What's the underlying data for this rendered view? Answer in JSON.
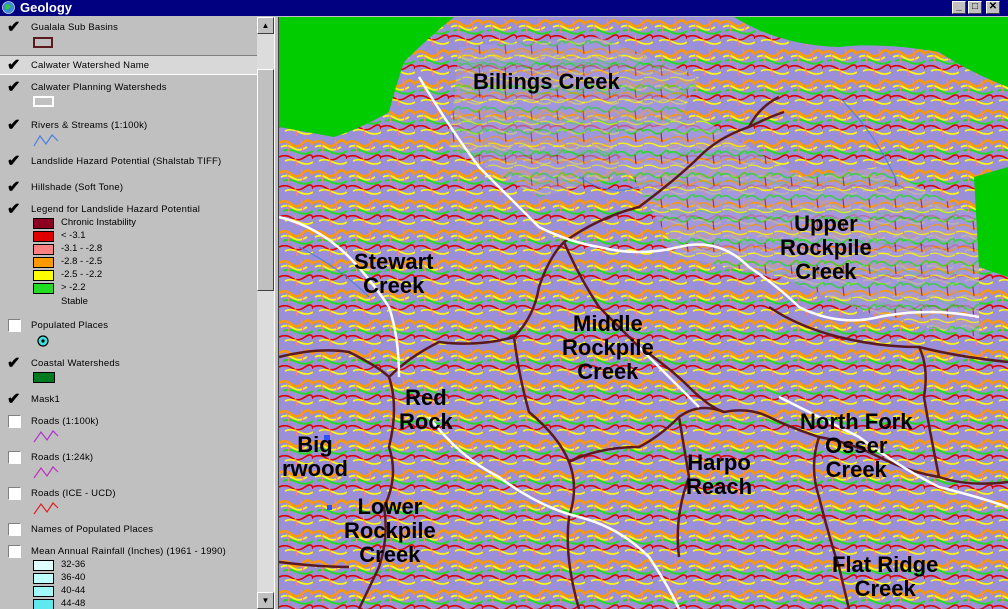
{
  "window": {
    "title": "Geology"
  },
  "toc": {
    "layers": [
      {
        "name": "Gualala Sub Basins",
        "checked": true
      },
      {
        "name": "Calwater Watershed Name",
        "checked": true
      },
      {
        "name": "Calwater Planning Watersheds",
        "checked": true
      },
      {
        "name": "Rivers & Streams (1:100k)",
        "checked": true
      },
      {
        "name": "Landslide Hazard Potential (Shalstab TIFF)",
        "checked": true
      },
      {
        "name": "Hillshade (Soft Tone)",
        "checked": true
      },
      {
        "name": "Legend for Landslide Hazard Potential",
        "checked": true
      },
      {
        "name": "Populated Places",
        "checked": false
      },
      {
        "name": "Coastal Watersheds",
        "checked": true
      },
      {
        "name": "Mask1",
        "checked": true
      },
      {
        "name": "Roads (1:100k)",
        "checked": false
      },
      {
        "name": "Roads (1:24k)",
        "checked": false
      },
      {
        "name": "Roads (ICE - UCD)",
        "checked": false
      },
      {
        "name": "Names of Populated Places",
        "checked": false
      },
      {
        "name": "Mean Annual Rainfall (Inches) (1961 - 1990)",
        "checked": false
      }
    ],
    "hazard_legend": [
      {
        "label": "Chronic Instability",
        "color": "#8b0020"
      },
      {
        "label": "< -3.1",
        "color": "#e00000"
      },
      {
        "label": "-3.1 - -2.8",
        "color": "#ff8080"
      },
      {
        "label": "-2.8 - -2.5",
        "color": "#ff9900"
      },
      {
        "label": "-2.5 - -2.2",
        "color": "#ffff00"
      },
      {
        "label": "> -2.2",
        "color": "#22dd22"
      }
    ],
    "hazard_stable_label": "Stable",
    "rainfall_legend": [
      {
        "label": "32-36",
        "color": "#e0ffff"
      },
      {
        "label": "36-40",
        "color": "#c0ffff"
      },
      {
        "label": "40-44",
        "color": "#a0f8f8"
      },
      {
        "label": "44-48",
        "color": "#60e8f0"
      }
    ]
  },
  "map": {
    "labels": [
      {
        "text": "Billings Creek"
      },
      {
        "text": "Upper\nRockpile\nCreek"
      },
      {
        "text": "Stewart\nCreek"
      },
      {
        "text": "Middle\nRockpile\nCreek"
      },
      {
        "text": "Red\nRock"
      },
      {
        "text": "North Fork\nOsser\nCreek"
      },
      {
        "text": "Big\nrwood"
      },
      {
        "text": "Harpo\nReach"
      },
      {
        "text": "Lower\nRockpile\nCreek"
      },
      {
        "text": "Flat Ridge\nCreek"
      }
    ],
    "colors": {
      "base": "#9b8fd8",
      "mask": "#00cc00",
      "boundary": "#5a1a20",
      "stream": "#ffffff"
    }
  }
}
